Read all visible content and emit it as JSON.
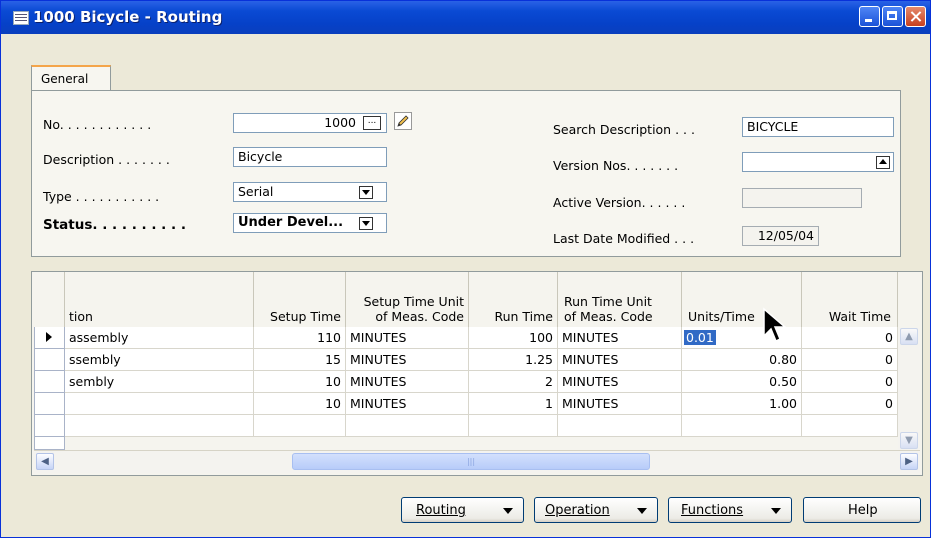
{
  "window": {
    "title": "1000 Bicycle - Routing"
  },
  "tabs": [
    {
      "label": "General"
    }
  ],
  "general": {
    "no_label": "No. . . . . . . . . . . .",
    "no_value": "1000",
    "description_label": "Description . . . . . . .",
    "description_value": "Bicycle",
    "type_label": "Type . . . . . . . . . . .",
    "type_value": "Serial",
    "status_label": "Status. . . . . . . . . .",
    "status_value": "Under Devel...",
    "search_description_label": "Search Description . . .",
    "search_description_value": "BICYCLE",
    "version_nos_label": "Version Nos. . . . . . .",
    "version_nos_value": "",
    "active_version_label": "Active Version. . . . . .",
    "active_version_value": "",
    "last_date_modified_label": "Last Date Modified . . .",
    "last_date_modified_value": "12/05/04"
  },
  "table": {
    "headers": {
      "description": "tion",
      "setup_time": "Setup Time",
      "setup_unit_1": "Setup Time Unit",
      "setup_unit_2": "of Meas. Code",
      "run_time": "Run Time",
      "run_unit_1": "Run Time Unit",
      "run_unit_2": "of Meas. Code",
      "units_time": "Units/Time",
      "wait_time": "Wait Time"
    },
    "rows": [
      {
        "description": "assembly",
        "setup_time": "110",
        "setup_unit": "MINUTES",
        "run_time": "100",
        "run_unit": "MINUTES",
        "units_time": "0.01",
        "wait_time": "0"
      },
      {
        "description": "ssembly",
        "setup_time": "15",
        "setup_unit": "MINUTES",
        "run_time": "1.25",
        "run_unit": "MINUTES",
        "units_time": "0.80",
        "wait_time": "0"
      },
      {
        "description": "sembly",
        "setup_time": "10",
        "setup_unit": "MINUTES",
        "run_time": "2",
        "run_unit": "MINUTES",
        "units_time": "0.50",
        "wait_time": "0"
      },
      {
        "description": "",
        "setup_time": "10",
        "setup_unit": "MINUTES",
        "run_time": "1",
        "run_unit": "MINUTES",
        "units_time": "1.00",
        "wait_time": "0"
      }
    ]
  },
  "buttons": {
    "routing": "Routing",
    "operation": "Operation",
    "functions": "Functions",
    "help": "Help"
  }
}
